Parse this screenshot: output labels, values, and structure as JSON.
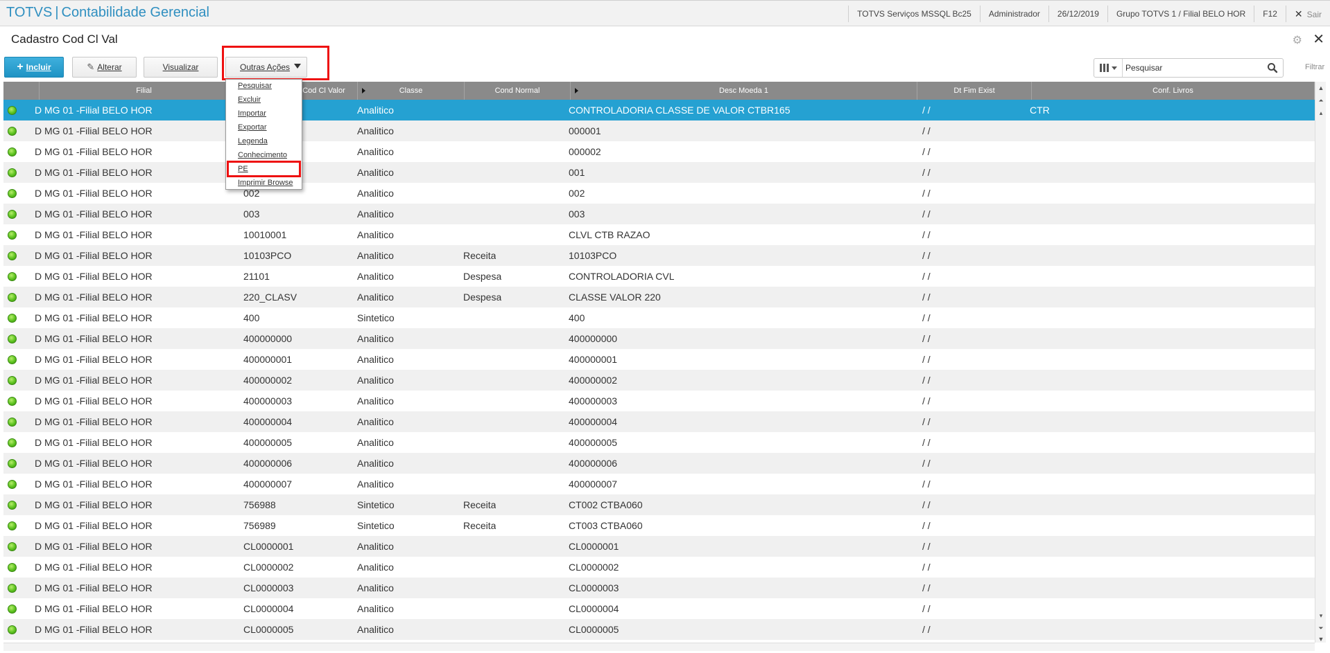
{
  "app": {
    "brand": "TOTVS",
    "separator": "|",
    "module": "Contabilidade Gerencial",
    "environment": "TOTVS Serviços MSSQL Bc25",
    "user": "Administrador",
    "date": "26/12/2019",
    "branch": "Grupo TOTVS 1 / Filial BELO HOR",
    "shortcut": "F12",
    "exit_label": "Sair"
  },
  "page": {
    "title": "Cadastro Cod Cl Val"
  },
  "toolbar": {
    "incluir": "Incluir",
    "alterar": "Alterar",
    "visualizar": "Visualizar",
    "outras_acoes": "Outras Ações"
  },
  "search": {
    "placeholder": "Pesquisar",
    "filter_label": "Filtrar"
  },
  "menu": {
    "items": [
      "Pesquisar",
      "Excluir",
      "Importar",
      "Exportar",
      "Legenda",
      "Conhecimento",
      "PE",
      "Imprimir Browse"
    ]
  },
  "grid": {
    "columns": [
      "",
      "Filial",
      "Cod Cl Valor",
      "Classe",
      "Cond Normal",
      "Desc Moeda 1",
      "Dt Fim Exist",
      "Conf. Livros"
    ],
    "rows": [
      {
        "filial": "D MG 01 -Filial BELO HOR",
        "cod": "",
        "classe": "Analitico",
        "cond": "",
        "desc": "CONTROLADORIA CLASSE DE VALOR CTBR165",
        "dt": "/  /",
        "conf": "CTR"
      },
      {
        "filial": "D MG 01 -Filial BELO HOR",
        "cod": "",
        "classe": "Analitico",
        "cond": "",
        "desc": "000001",
        "dt": "/  /",
        "conf": ""
      },
      {
        "filial": "D MG 01 -Filial BELO HOR",
        "cod": "",
        "classe": "Analitico",
        "cond": "",
        "desc": "000002",
        "dt": "/  /",
        "conf": ""
      },
      {
        "filial": "D MG 01 -Filial BELO HOR",
        "cod": "",
        "classe": "Analitico",
        "cond": "",
        "desc": "001",
        "dt": "/  /",
        "conf": ""
      },
      {
        "filial": "D MG 01 -Filial BELO HOR",
        "cod": "002",
        "classe": "Analitico",
        "cond": "",
        "desc": "002",
        "dt": "/  /",
        "conf": ""
      },
      {
        "filial": "D MG 01 -Filial BELO HOR",
        "cod": "003",
        "classe": "Analitico",
        "cond": "",
        "desc": "003",
        "dt": "/  /",
        "conf": ""
      },
      {
        "filial": "D MG 01 -Filial BELO HOR",
        "cod": "10010001",
        "classe": "Analitico",
        "cond": "",
        "desc": "CLVL CTB RAZAO",
        "dt": "/  /",
        "conf": ""
      },
      {
        "filial": "D MG 01 -Filial BELO HOR",
        "cod": "10103PCO",
        "classe": "Analitico",
        "cond": "Receita",
        "desc": "10103PCO",
        "dt": "/  /",
        "conf": ""
      },
      {
        "filial": "D MG 01 -Filial BELO HOR",
        "cod": "21101",
        "classe": "Analitico",
        "cond": "Despesa",
        "desc": "CONTROLADORIA CVL",
        "dt": "/  /",
        "conf": ""
      },
      {
        "filial": "D MG 01 -Filial BELO HOR",
        "cod": "220_CLASV",
        "classe": "Analitico",
        "cond": "Despesa",
        "desc": "CLASSE VALOR 220",
        "dt": "/  /",
        "conf": ""
      },
      {
        "filial": "D MG 01 -Filial BELO HOR",
        "cod": "400",
        "classe": "Sintetico",
        "cond": "",
        "desc": "400",
        "dt": "/  /",
        "conf": ""
      },
      {
        "filial": "D MG 01 -Filial BELO HOR",
        "cod": "400000000",
        "classe": "Analitico",
        "cond": "",
        "desc": "400000000",
        "dt": "/  /",
        "conf": ""
      },
      {
        "filial": "D MG 01 -Filial BELO HOR",
        "cod": "400000001",
        "classe": "Analitico",
        "cond": "",
        "desc": "400000001",
        "dt": "/  /",
        "conf": ""
      },
      {
        "filial": "D MG 01 -Filial BELO HOR",
        "cod": "400000002",
        "classe": "Analitico",
        "cond": "",
        "desc": "400000002",
        "dt": "/  /",
        "conf": ""
      },
      {
        "filial": "D MG 01 -Filial BELO HOR",
        "cod": "400000003",
        "classe": "Analitico",
        "cond": "",
        "desc": "400000003",
        "dt": "/  /",
        "conf": ""
      },
      {
        "filial": "D MG 01 -Filial BELO HOR",
        "cod": "400000004",
        "classe": "Analitico",
        "cond": "",
        "desc": "400000004",
        "dt": "/  /",
        "conf": ""
      },
      {
        "filial": "D MG 01 -Filial BELO HOR",
        "cod": "400000005",
        "classe": "Analitico",
        "cond": "",
        "desc": "400000005",
        "dt": "/  /",
        "conf": ""
      },
      {
        "filial": "D MG 01 -Filial BELO HOR",
        "cod": "400000006",
        "classe": "Analitico",
        "cond": "",
        "desc": "400000006",
        "dt": "/  /",
        "conf": ""
      },
      {
        "filial": "D MG 01 -Filial BELO HOR",
        "cod": "400000007",
        "classe": "Analitico",
        "cond": "",
        "desc": "400000007",
        "dt": "/  /",
        "conf": ""
      },
      {
        "filial": "D MG 01 -Filial BELO HOR",
        "cod": "756988",
        "classe": "Sintetico",
        "cond": "Receita",
        "desc": "CT002 CTBA060",
        "dt": "/  /",
        "conf": ""
      },
      {
        "filial": "D MG 01 -Filial BELO HOR",
        "cod": "756989",
        "classe": "Sintetico",
        "cond": "Receita",
        "desc": "CT003 CTBA060",
        "dt": "/  /",
        "conf": ""
      },
      {
        "filial": "D MG 01 -Filial BELO HOR",
        "cod": "CL0000001",
        "classe": "Analitico",
        "cond": "",
        "desc": "CL0000001",
        "dt": "/  /",
        "conf": ""
      },
      {
        "filial": "D MG 01 -Filial BELO HOR",
        "cod": "CL0000002",
        "classe": "Analitico",
        "cond": "",
        "desc": "CL0000002",
        "dt": "/  /",
        "conf": ""
      },
      {
        "filial": "D MG 01 -Filial BELO HOR",
        "cod": "CL0000003",
        "classe": "Analitico",
        "cond": "",
        "desc": "CL0000003",
        "dt": "/  /",
        "conf": ""
      },
      {
        "filial": "D MG 01 -Filial BELO HOR",
        "cod": "CL0000004",
        "classe": "Analitico",
        "cond": "",
        "desc": "CL0000004",
        "dt": "/  /",
        "conf": ""
      },
      {
        "filial": "D MG 01 -Filial BELO HOR",
        "cod": "CL0000005",
        "classe": "Analitico",
        "cond": "",
        "desc": "CL0000005",
        "dt": "/  /",
        "conf": ""
      }
    ]
  },
  "colors": {
    "accent": "#25a1d2",
    "highlight": "#ee1111",
    "status_ok": "#5cc21f"
  }
}
